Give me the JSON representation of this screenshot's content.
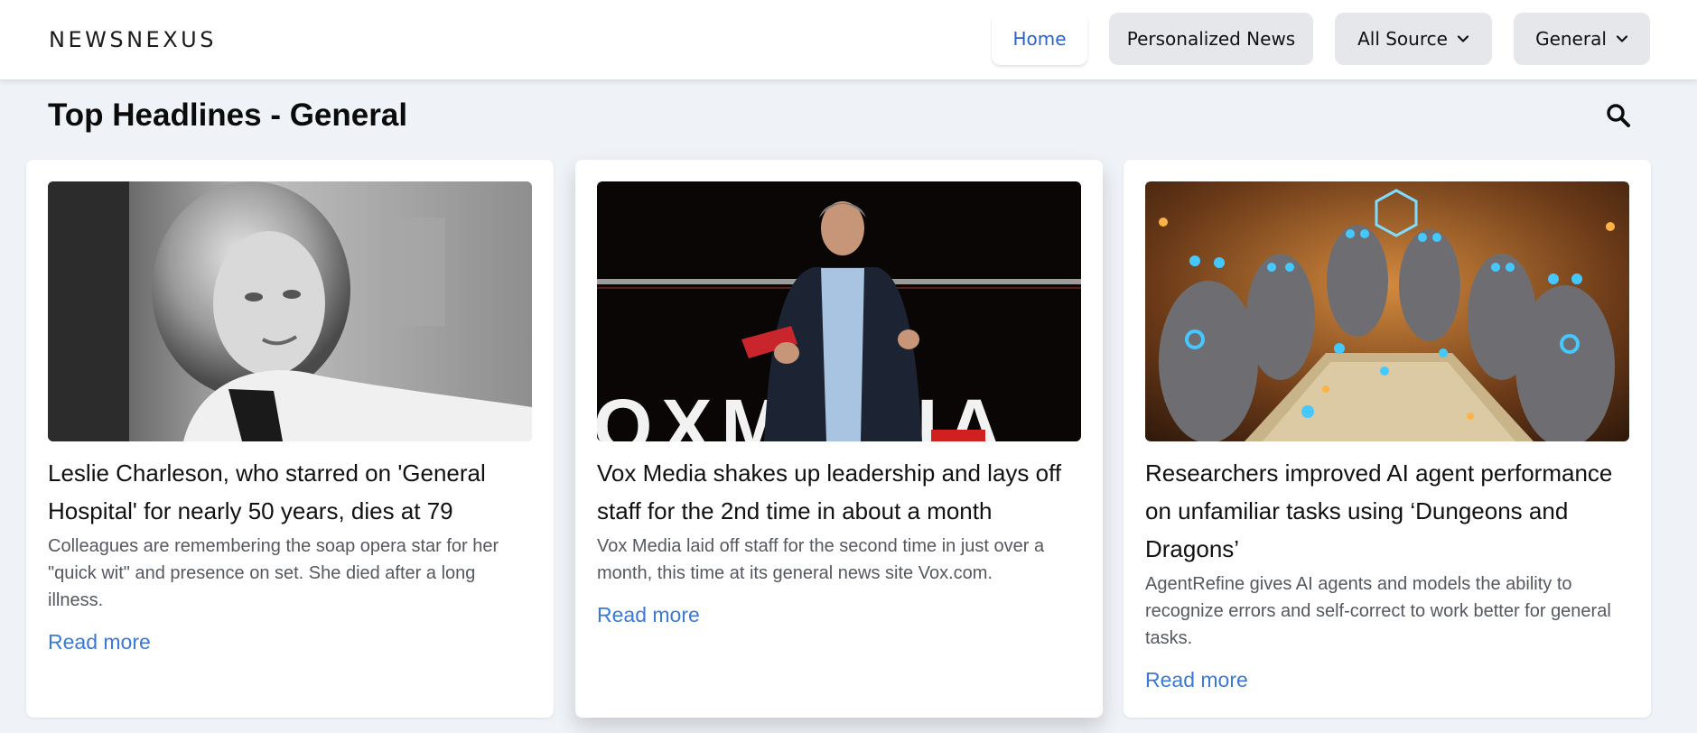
{
  "header": {
    "brand": "NEWSNEXUS",
    "nav": {
      "home": "Home",
      "personalized": "Personalized News",
      "source": "All Source",
      "category": "General"
    }
  },
  "page": {
    "title": "Top Headlines - General",
    "search_icon": "search-icon"
  },
  "colors": {
    "accent": "#3b79d9",
    "background": "#eff2f7",
    "nav_button": "#e5e7eb"
  },
  "articles": [
    {
      "title": "Leslie Charleson, who starred on 'General Hospital' for nearly 50 years, dies at 79",
      "description": "Colleagues are remembering the soap opera star for her \"quick wit\" and presence on set. She died after a long illness.",
      "link": "Read more",
      "image": "black-and-white portrait of a smiling woman"
    },
    {
      "title": "Vox Media shakes up leadership and lays off staff for the 2nd time in about a month",
      "description": "Vox Media laid off staff for the second time in just over a month, this time at its general news site Vox.com.",
      "link": "Read more",
      "image": "man speaking on stage holding a red card",
      "image_text": "OXMEDIA"
    },
    {
      "title": "Researchers improved AI agent performance on unfamiliar tasks using ‘Dungeons and Dragons’",
      "description": "AgentRefine gives AI agents and models the ability to recognize errors and self-correct to work better for general tasks.",
      "link": "Read more",
      "image": "robots playing a tabletop game with dice"
    }
  ]
}
